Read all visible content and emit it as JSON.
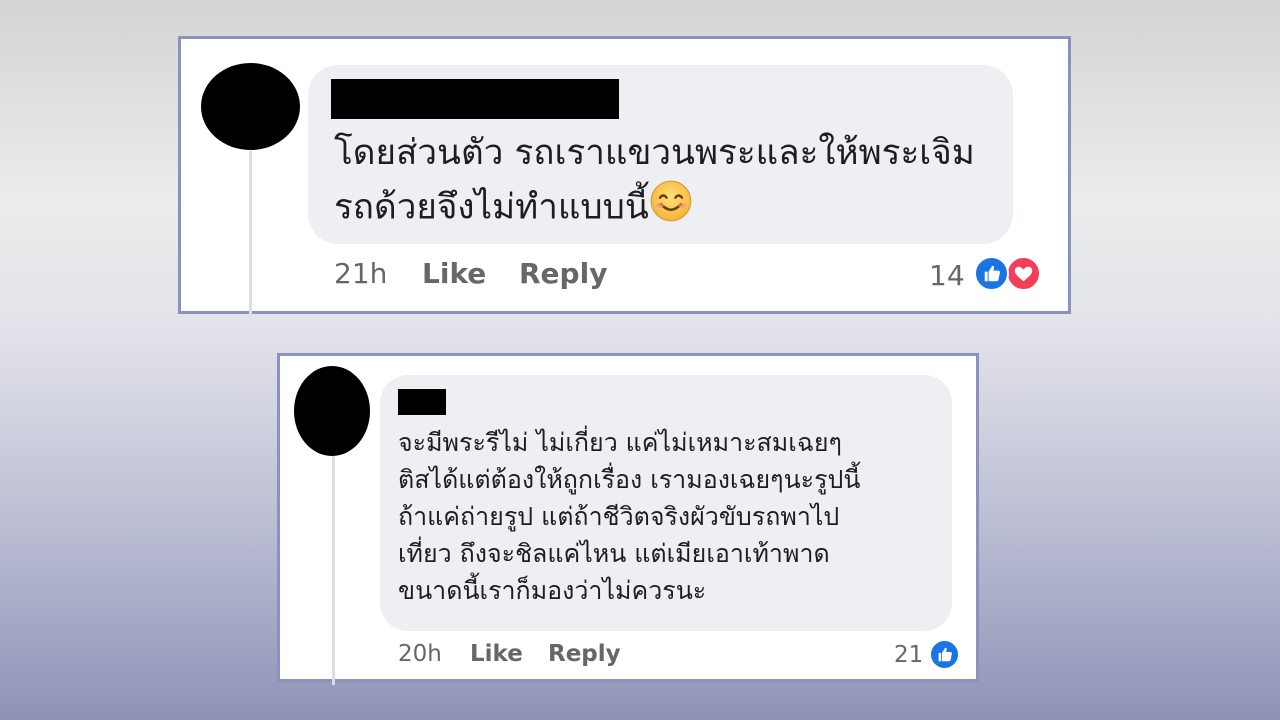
{
  "comments": [
    {
      "text": "โดยส่วนตัว รถเราแขวนพระและให้พระเจิม\nรถด้วยจึงไม่ทำแบบนี้",
      "emoji": "😊",
      "time": "21h",
      "like_label": "Like",
      "reply_label": "Reply",
      "reaction_count": "14",
      "reactions": [
        "like-icon",
        "love-icon"
      ]
    },
    {
      "text": "จะมีพระรีไม่ ไม่เกี่ยว แค่ไม่เหมาะสมเฉยๆ\nติสได้แต่ต้องให้ถูกเรื่อง เรามองเฉยๆนะรูปนี้\nถ้าแค่ถ่ายรูป  แต่ถ้าชีวิตจริงผัวขับรถพาไป\nเที่ยว ถึงจะชิลแค่ไหน แต่เมียเอาเท้าพาด\nขนาดนี้เราก็มองว่าไม่ควรนะ",
      "time": "20h",
      "like_label": "Like",
      "reply_label": "Reply",
      "reaction_count": "21",
      "reactions": [
        "like-icon"
      ]
    }
  ],
  "colors": {
    "bubble": "#eeeff2",
    "card_border": "#8a92bd",
    "meta_text": "#65676b",
    "like_blue": "#1b74e4",
    "love_red": "#f33e58"
  }
}
